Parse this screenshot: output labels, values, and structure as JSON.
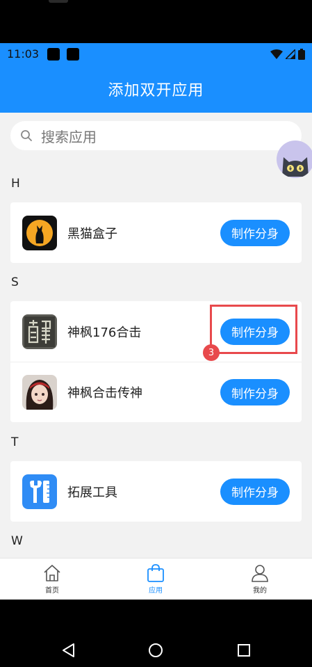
{
  "status_bar": {
    "time": "11:03"
  },
  "header": {
    "title": "添加双开应用"
  },
  "search": {
    "placeholder": "搜索应用"
  },
  "sections": [
    {
      "letter": "H",
      "apps": [
        {
          "name": "黑猫盒子",
          "button": "制作分身"
        }
      ]
    },
    {
      "letter": "S",
      "apps": [
        {
          "name": "神枫176合击",
          "button": "制作分身"
        },
        {
          "name": "神枫合击传神",
          "button": "制作分身"
        }
      ]
    },
    {
      "letter": "T",
      "apps": [
        {
          "name": "拓展工具",
          "button": "制作分身"
        }
      ]
    },
    {
      "letter": "W",
      "apps": []
    }
  ],
  "annotation": {
    "step": "3"
  },
  "tabbar": {
    "items": [
      {
        "label": "首页"
      },
      {
        "label": "应用",
        "active": true
      },
      {
        "label": "我的"
      }
    ]
  },
  "colors": {
    "accent": "#1a8fff",
    "highlight": "#e8494c",
    "background": "#f2f2f2"
  }
}
